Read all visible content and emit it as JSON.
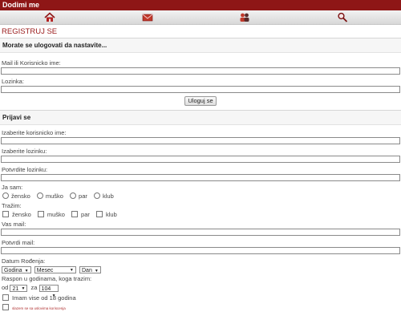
{
  "header": {
    "title": "Dodimi me"
  },
  "nav": [
    "home-icon",
    "mail-icon",
    "users-icon",
    "search-icon"
  ],
  "page_title": "REGISTRUJ SE",
  "login": {
    "heading": "Morate se ulogovati da nastavite...",
    "user_label": "Mail ili Korisnicko ime:",
    "password_label": "Lozinka:",
    "submit": "Uloguj se"
  },
  "register": {
    "heading": "Prijavi se",
    "username_label": "Izaberite korisnicko ime:",
    "password_label": "Izaberite lozinku:",
    "confirm_label": "Potvrdite lozinku:",
    "i_am_label": "Ja sam:",
    "i_am_options": [
      "žensko",
      "muško",
      "par",
      "klub"
    ],
    "seeking_label": "Tražim:",
    "seeking_options": [
      "žensko",
      "muško",
      "par",
      "klub"
    ],
    "email_label": "Vas mail:",
    "confirm_email_label": "Potvrdi mail:",
    "dob_label": "Datum Rođenja:",
    "dob_year": "Godina",
    "dob_month": "Mesec",
    "dob_day": "Dan",
    "age_range_label": "Raspon u godinama, koga trazim:",
    "age_from_label": "od",
    "age_from": "21",
    "age_to_label": "za",
    "age_to": "104",
    "over18_label": "Imam vise od 18 godina",
    "terms_label": "slazem se sa uslovima koriscenja"
  },
  "colors": {
    "topbar": "#8e1616",
    "title": "#9a1a1a"
  }
}
